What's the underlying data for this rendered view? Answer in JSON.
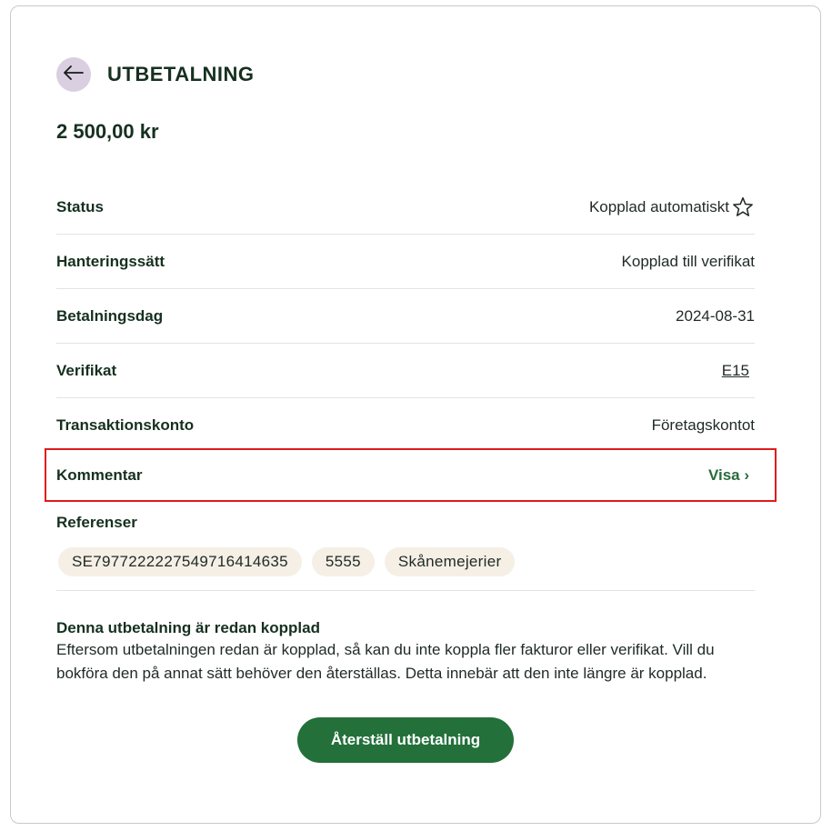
{
  "header": {
    "title": "UTBETALNING",
    "back_icon": "arrow-left-icon"
  },
  "amount": "2 500,00 kr",
  "details": [
    {
      "label": "Status",
      "value": "Kopplad automatiskt",
      "icon": "star-outline-icon"
    },
    {
      "label": "Hanteringssätt",
      "value": "Kopplad till verifikat"
    },
    {
      "label": "Betalningsdag",
      "value": "2024-08-31"
    },
    {
      "label": "Verifikat",
      "value": "E15",
      "is_link": true
    },
    {
      "label": "Transaktionskonto",
      "value": "Företagskontot"
    }
  ],
  "comment": {
    "label": "Kommentar",
    "action": "Visa ›"
  },
  "references": {
    "title": "Referenser",
    "items": [
      "SE7977222227549716414635",
      "5555",
      "Skånemejerier"
    ]
  },
  "notice": {
    "title": "Denna utbetalning är redan kopplad",
    "body": "Eftersom utbetalningen redan är kopplad, så kan du inte koppla fler fakturor eller verifikat. Vill du bokföra den på annat sätt behöver den återställas. Detta innebär att den inte längre är kopplad."
  },
  "reset_button": "Återställ utbetalning",
  "colors": {
    "primary": "#23703a",
    "highlight_border": "#e01b1b",
    "chip_bg": "#f5efe6",
    "back_bg": "#d9cfe0",
    "link": "#3a6fc4"
  }
}
